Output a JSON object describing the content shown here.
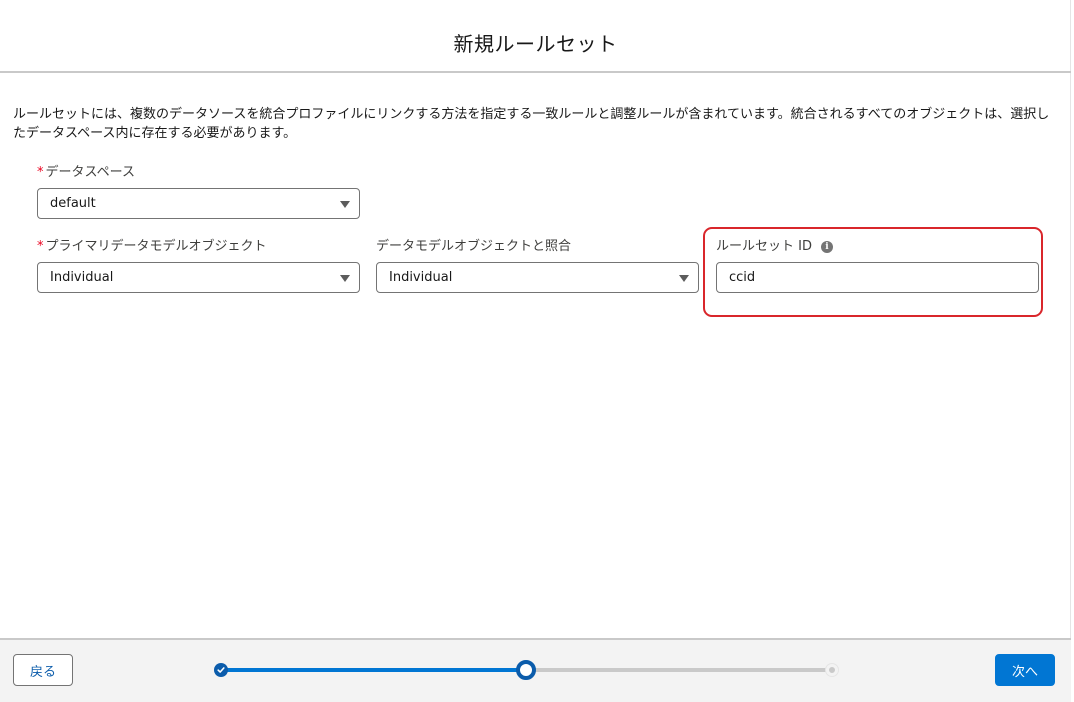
{
  "modal": {
    "title": "新規ルールセット",
    "description": "ルールセットには、複数のデータソースを統合プロファイルにリンクする方法を指定する一致ルールと調整ルールが含まれています。統合されるすべてのオブジェクトは、選択したデータスペース内に存在する必要があります。"
  },
  "form": {
    "data_space": {
      "required_mark": "*",
      "label": "データスペース",
      "value": "default"
    },
    "primary_dmo": {
      "required_mark": "*",
      "label": "プライマリデータモデルオブジェクト",
      "value": "Individual"
    },
    "dmo_match": {
      "label": "データモデルオブジェクトと照合",
      "value": "Individual"
    },
    "ruleset_id": {
      "label": "ルールセット ID",
      "info_icon": "i",
      "value": "ccid"
    }
  },
  "footer": {
    "back_label": "戻る",
    "next_label": "次へ",
    "progress": {
      "total_steps": 3,
      "current_step": 2
    }
  },
  "colors": {
    "brand": "#0176d3",
    "highlight": "#d9262b",
    "required": "#ea001e"
  }
}
